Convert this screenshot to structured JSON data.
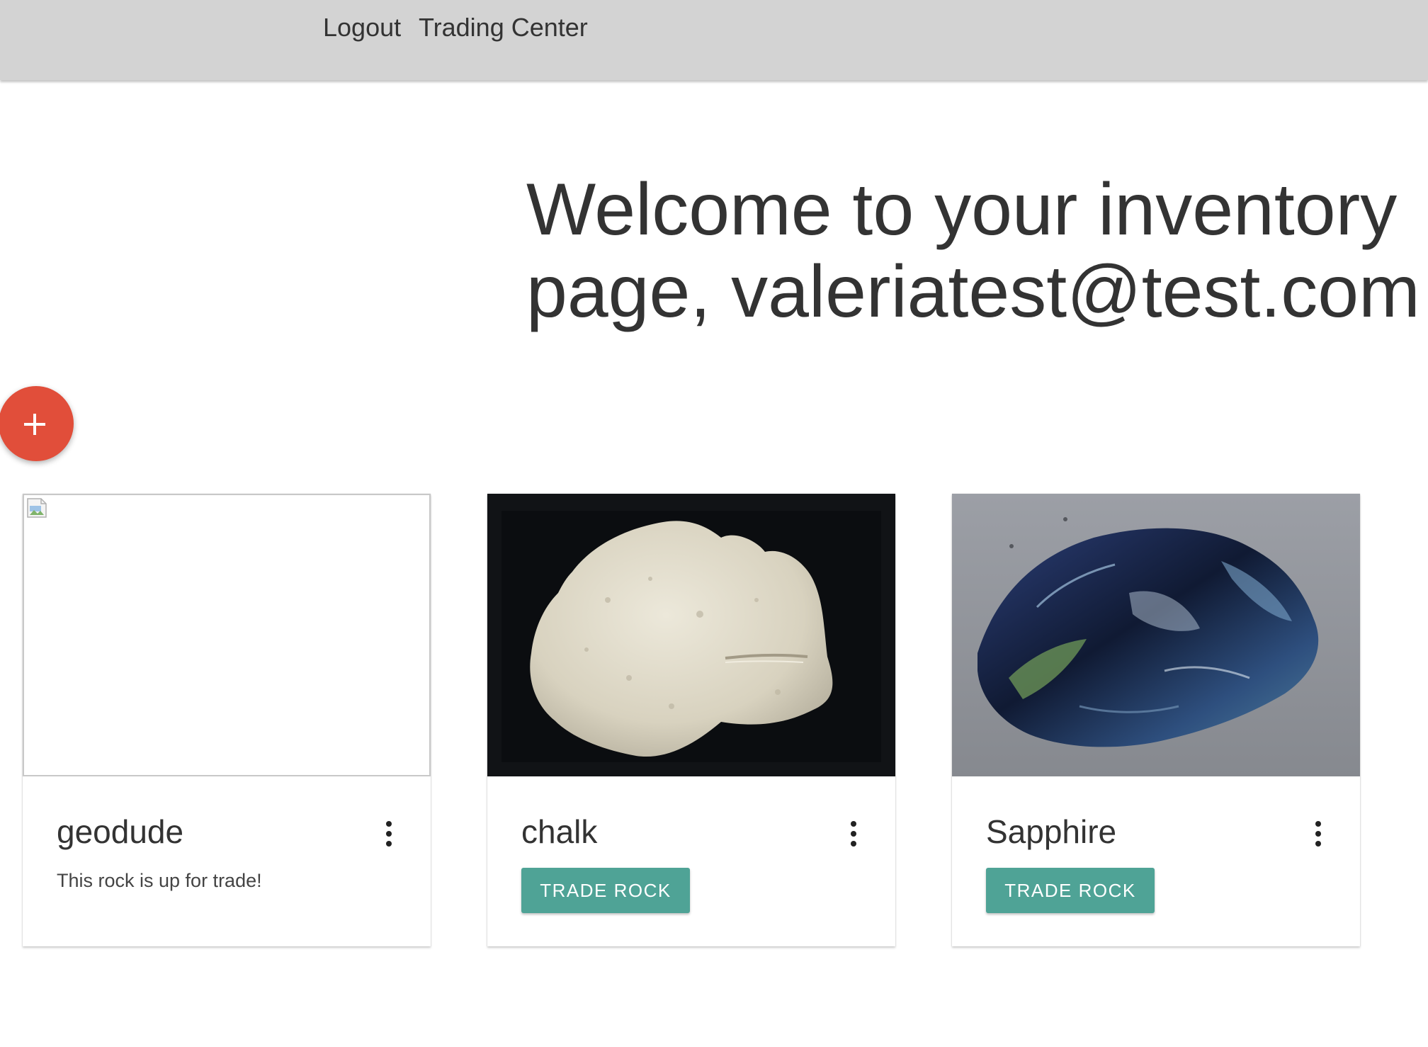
{
  "navbar": {
    "links": [
      "Logout",
      "Trading Center"
    ]
  },
  "header": {
    "welcome_line1": "Welcome to your inventory",
    "welcome_line2": "page, valeriatest@test.com"
  },
  "fab": {
    "icon": "plus-icon",
    "color": "#e14e3a"
  },
  "inventory": {
    "cards": [
      {
        "title": "geodude",
        "image": "broken-image-icon",
        "description": "This rock is up for trade!"
      },
      {
        "title": "chalk",
        "image": "chalk-rock-photo",
        "button_label": "Trade Rock"
      },
      {
        "title": "Sapphire",
        "image": "sapphire-rock-photo",
        "button_label": "Trade Rock"
      }
    ]
  },
  "colors": {
    "navbar_bg": "#d3d3d3",
    "accent_button": "#4fa396",
    "fab": "#e14e3a"
  }
}
